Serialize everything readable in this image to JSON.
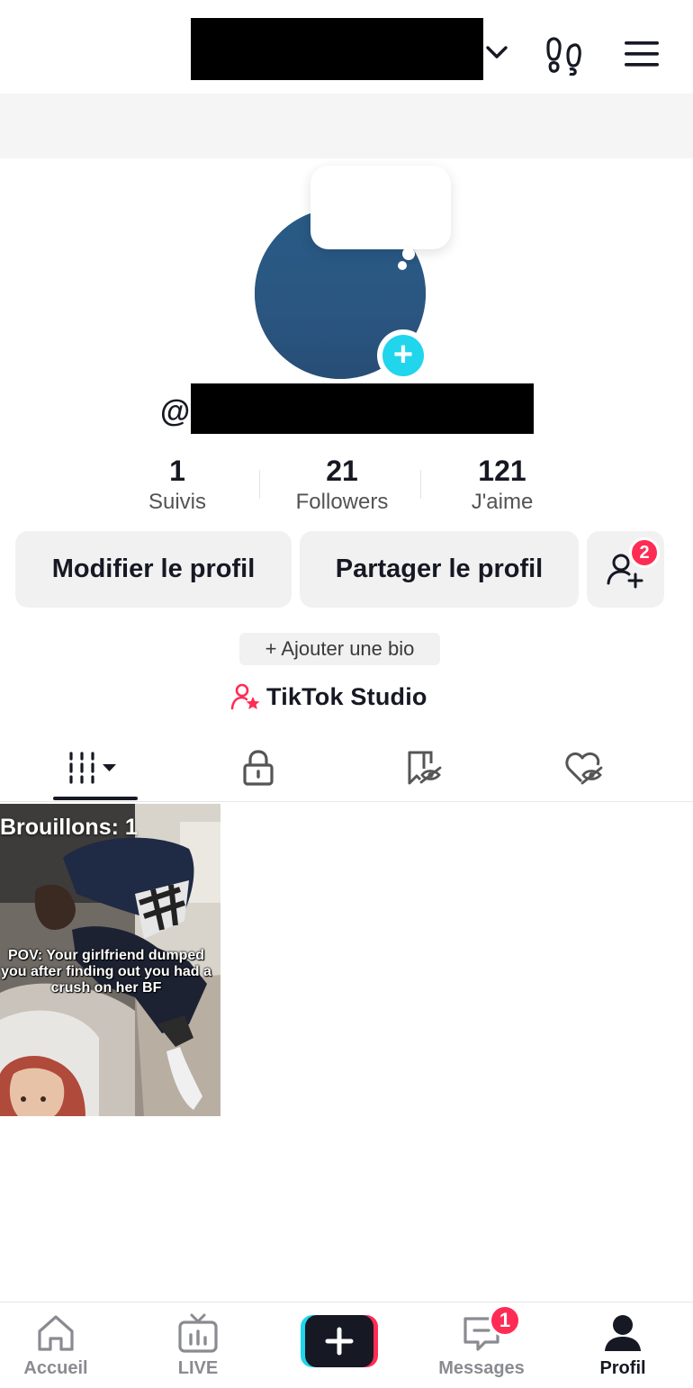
{
  "header": {
    "account_switch_icon": "chevron-down-icon",
    "footprint_icon": "footprint-icon",
    "menu_icon": "hamburger-menu-icon"
  },
  "profile": {
    "username_prefix": "@",
    "avatar_add_label": "+",
    "avatar_color": "#2a5681",
    "accent_color": "#20d5ec"
  },
  "stats": [
    {
      "value": "1",
      "label": "Suivis"
    },
    {
      "value": "21",
      "label": "Followers"
    },
    {
      "value": "121",
      "label": "J'aime"
    }
  ],
  "buttons": {
    "edit_profile": "Modifier le profil",
    "share_profile": "Partager le profil",
    "add_friends_badge": "2"
  },
  "bio": {
    "add_bio": "+ Ajouter une bio"
  },
  "studio": {
    "label": "TikTok Studio",
    "icon": "creator-star-icon"
  },
  "tabs": [
    {
      "name": "videos",
      "icon": "grid-icon",
      "active": true
    },
    {
      "name": "private",
      "icon": "lock-icon"
    },
    {
      "name": "favorites",
      "icon": "bookmark-hidden-icon"
    },
    {
      "name": "liked",
      "icon": "heart-hidden-icon"
    }
  ],
  "drafts": {
    "label": "Brouillons: 1",
    "caption": "POV: Your girlfriend dumped you after finding out you had a crush on her BF"
  },
  "bottom_nav": {
    "home": "Accueil",
    "live": "LIVE",
    "create": "+",
    "messages": "Messages",
    "messages_badge": "1",
    "profile": "Profil"
  },
  "colors": {
    "badge": "#fe2c55",
    "text": "#161823",
    "secondary_text": "#8a8b91"
  }
}
